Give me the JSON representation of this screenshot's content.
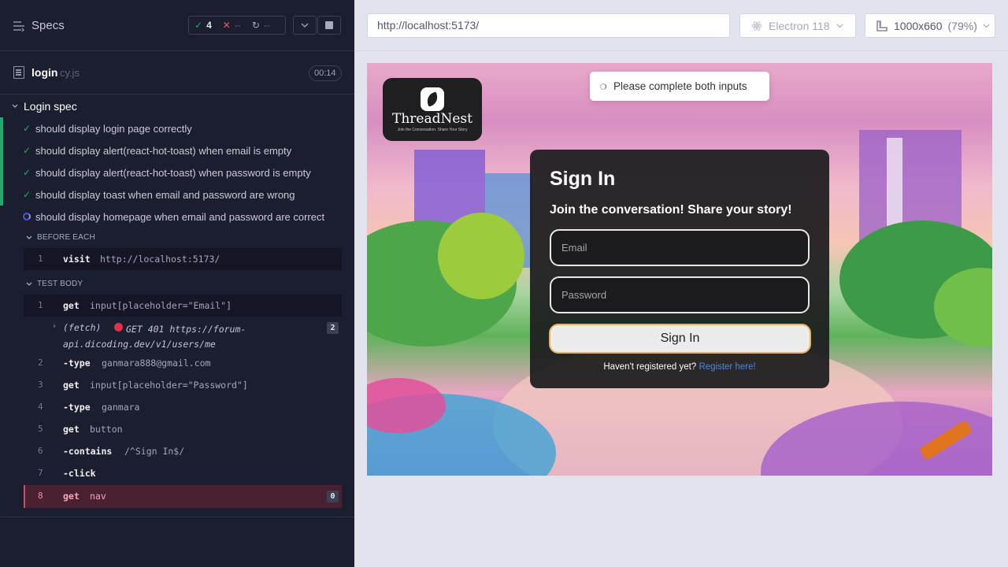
{
  "runner": {
    "specs_label": "Specs",
    "stats": {
      "passed": "4",
      "failed": "--",
      "pending": "--"
    },
    "file": {
      "name": "login",
      "ext": "cy.js",
      "duration": "00:14"
    },
    "suite": "Login spec",
    "tests": [
      {
        "label": "should display login page correctly",
        "state": "passed"
      },
      {
        "label": "should display alert(react-hot-toast) when email is empty",
        "state": "passed"
      },
      {
        "label": "should display alert(react-hot-toast) when password is empty",
        "state": "passed"
      },
      {
        "label": "should display toast when email and password are wrong",
        "state": "passed"
      },
      {
        "label": "should display homepage when email and password are correct",
        "state": "running"
      }
    ],
    "before_each": {
      "title": "BEFORE EACH",
      "commands": [
        {
          "num": "1",
          "name": "visit",
          "arg": "http://localhost:5173/"
        }
      ]
    },
    "test_body": {
      "title": "TEST BODY",
      "commands": [
        {
          "num": "1",
          "name": "get",
          "arg": "input[placeholder=\"Email\"]"
        },
        {
          "num": "2",
          "name": "-type",
          "arg": "ganmara888@gmail.com"
        },
        {
          "num": "3",
          "name": "get",
          "arg": "input[placeholder=\"Password\"]"
        },
        {
          "num": "4",
          "name": "-type",
          "arg": "ganmara"
        },
        {
          "num": "5",
          "name": "get",
          "arg": "button"
        },
        {
          "num": "6",
          "name": "-contains",
          "arg": "/^Sign In$/"
        },
        {
          "num": "7",
          "name": "-click",
          "arg": ""
        },
        {
          "num": "8",
          "name": "get",
          "arg": "nav",
          "badge": "0"
        }
      ],
      "fetch": {
        "label": "(fetch)",
        "text": "GET 401 https://forum-api.dicoding.dev/v1/users/me",
        "count": "2"
      }
    }
  },
  "toolbar": {
    "url": "http://localhost:5173/",
    "browser": "Electron 118",
    "viewport": "1000x660",
    "zoom": "(79%)"
  },
  "app": {
    "brand": {
      "name": "ThreadNest",
      "tagline": "Join the Conversation. Share Your Story"
    },
    "toast": "Please complete both inputs",
    "form": {
      "title": "Sign In",
      "subtitle": "Join the conversation! Share your story!",
      "email_placeholder": "Email",
      "password_placeholder": "Password",
      "button": "Sign In",
      "register_prompt": "Haven't registered yet?",
      "register_link": "Register here!"
    }
  },
  "colors": {
    "pass": "#1fa971",
    "fail": "#e45770",
    "runner_bg": "#1b1e2e",
    "active_cmd": "#4a2133",
    "button_border": "#e6b35a",
    "link": "#4a86e8"
  }
}
